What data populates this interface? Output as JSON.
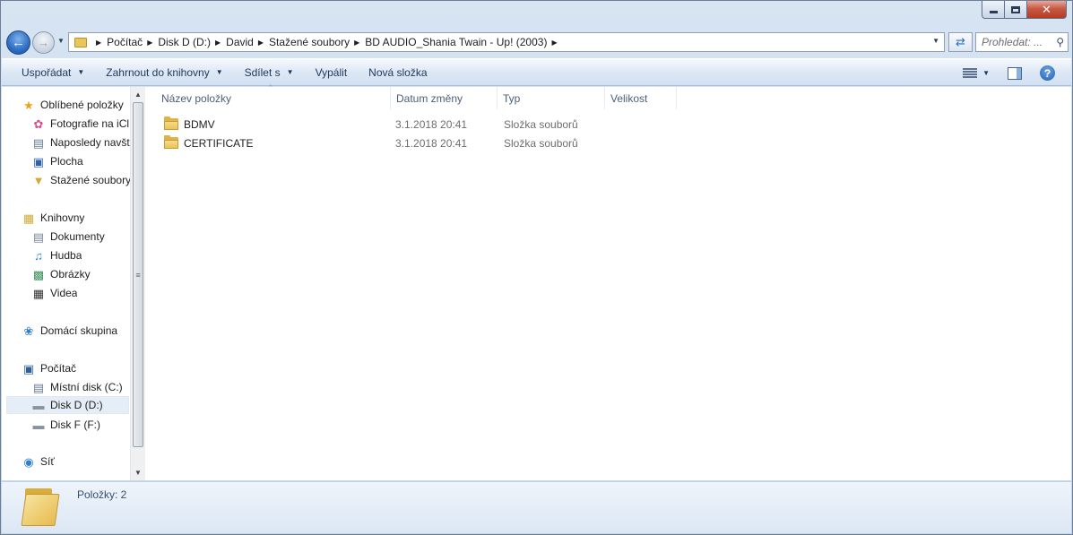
{
  "window": {
    "caption_buttons": {
      "minimize": "",
      "maximize": "",
      "close": "✕"
    }
  },
  "navigation": {
    "back_icon": "arrow-left-icon",
    "forward_icon": "arrow-right-icon"
  },
  "address": {
    "crumbs": [
      "Počítač",
      "Disk D (D:)",
      "David",
      "Stažené soubory",
      "BD AUDIO_Shania Twain - Up! (2003)"
    ]
  },
  "search": {
    "placeholder": "Prohledat: ..."
  },
  "toolbar": {
    "organize": "Uspořádat",
    "include_in_library": "Zahrnout do knihovny",
    "share_with": "Sdílet s",
    "burn": "Vypálit",
    "new_folder": "Nová složka"
  },
  "nav_pane": {
    "favorites": {
      "label": "Oblíbené položky",
      "items": [
        "Fotografie na iCl",
        "Naposledy navšt",
        "Plocha",
        "Stažené soubory"
      ]
    },
    "libraries": {
      "label": "Knihovny",
      "items": [
        "Dokumenty",
        "Hudba",
        "Obrázky",
        "Videa"
      ]
    },
    "homegroup": {
      "label": "Domácí skupina"
    },
    "computer": {
      "label": "Počítač",
      "items": [
        "Místní disk (C:)",
        "Disk D (D:)",
        "Disk F (F:)"
      ],
      "selected": "Disk D (D:)"
    },
    "network": {
      "label": "Síť"
    }
  },
  "columns": [
    "Název položky",
    "Datum změny",
    "Typ",
    "Velikost"
  ],
  "files": [
    {
      "name": "BDMV",
      "modified": "3.1.2018 20:41",
      "type": "Složka souborů",
      "size": ""
    },
    {
      "name": "CERTIFICATE",
      "modified": "3.1.2018 20:41",
      "type": "Složka souborů",
      "size": ""
    }
  ],
  "status": {
    "items_count": "Položky: 2"
  }
}
